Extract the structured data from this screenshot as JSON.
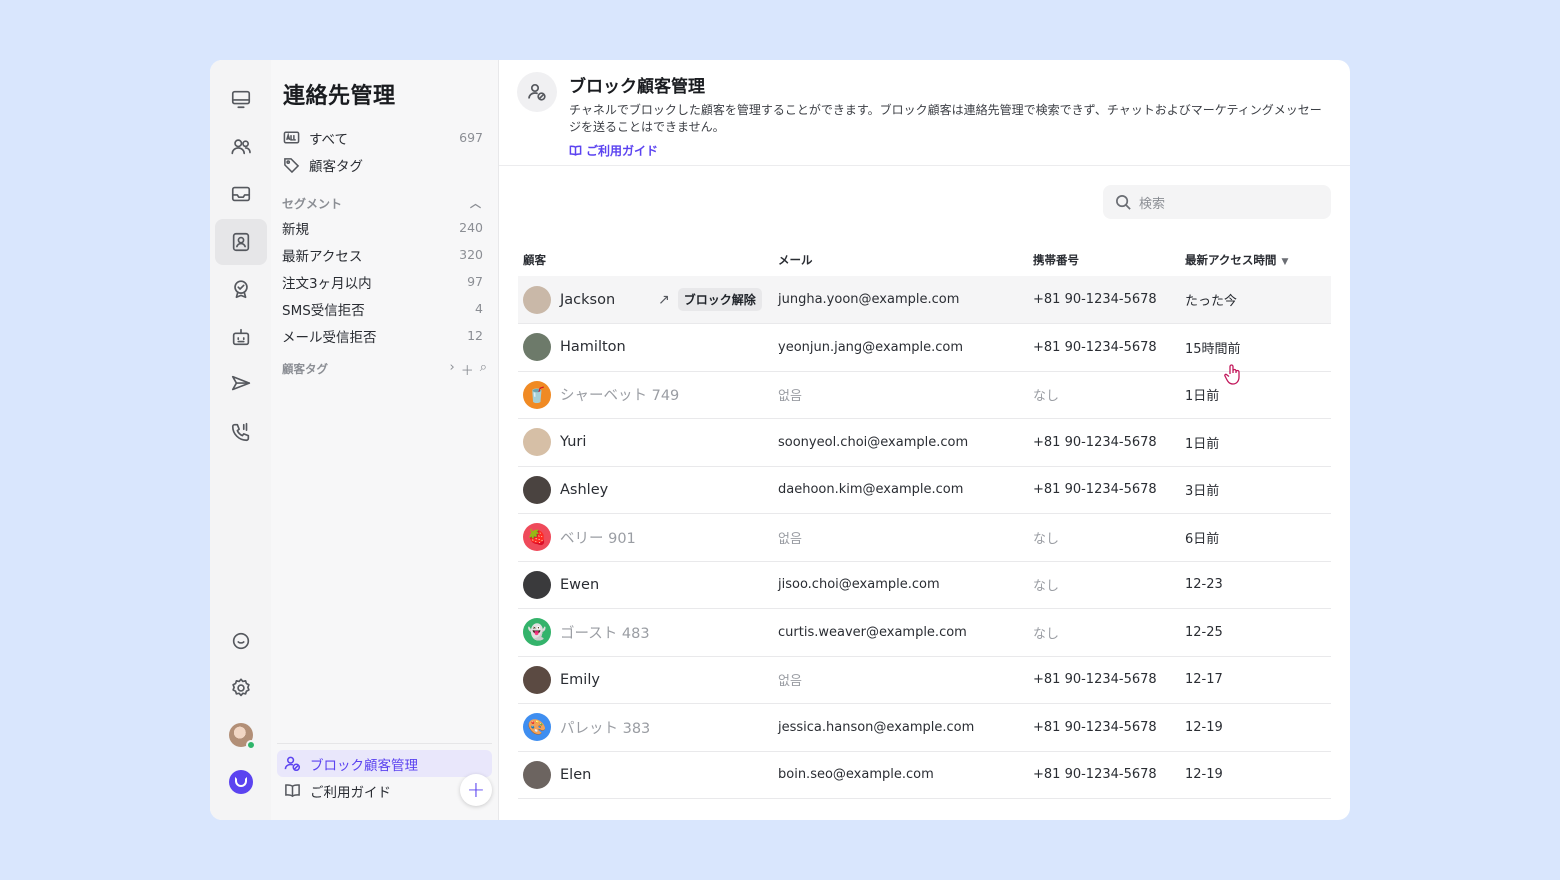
{
  "app": {
    "rail_icons": [
      "monitor-icon",
      "users-icon",
      "inbox-icon",
      "contacts-icon",
      "badge-check-icon",
      "bot-icon",
      "send-icon",
      "phone-icon"
    ],
    "rail_bottom_icons": [
      "chat-bubble-icon",
      "settings-icon",
      "user-avatar",
      "brand-logo"
    ]
  },
  "sidebar": {
    "title": "連絡先管理",
    "top_items": [
      {
        "icon": "all-icon",
        "label": "すべて",
        "count": "697"
      },
      {
        "icon": "tag-icon",
        "label": "顧客タグ",
        "count": ""
      }
    ],
    "segment_header": "セグメント",
    "segments": [
      {
        "label": "新規",
        "count": "240"
      },
      {
        "label": "最新アクセス",
        "count": "320"
      },
      {
        "label": "注文3ヶ月以内",
        "count": "97"
      },
      {
        "label": "SMS受信拒否",
        "count": "4"
      },
      {
        "label": "メール受信拒否",
        "count": "12"
      }
    ],
    "tag_header": "顧客タグ",
    "footer_items": [
      {
        "label": "ブロック顧客管理"
      },
      {
        "label": "ご利用ガイド"
      }
    ]
  },
  "header": {
    "title": "ブロック顧客管理",
    "description": "チャネルでブロックした顧客を管理することができます。ブロック顧客は連絡先管理で検索できず、チャットおよびマーケティングメッセージを送ることはできません。",
    "guide_link": "ご利用ガイド"
  },
  "search": {
    "placeholder": "検索"
  },
  "table": {
    "columns": [
      "顧客",
      "メール",
      "携帯番号",
      "最新アクセス時間"
    ],
    "unblock_label": "ブロック解除",
    "rows": [
      {
        "name": "Jackson",
        "guest": false,
        "email": "jungha.yoon@example.com",
        "phone": "+81 90-1234-5678",
        "last": "たった今",
        "avatar": "#c9b8a8",
        "glyph": ""
      },
      {
        "name": "Hamilton",
        "guest": false,
        "email": "yeonjun.jang@example.com",
        "phone": "+81 90-1234-5678",
        "last": "15時間前",
        "avatar": "#6d7a6a",
        "glyph": ""
      },
      {
        "name": "シャーベット 749",
        "guest": true,
        "email": "없음",
        "phone": "なし",
        "last": "1日前",
        "avatar": "#f08a24",
        "glyph": "🥤"
      },
      {
        "name": "Yuri",
        "guest": false,
        "email": "soonyeol.choi@example.com",
        "phone": "+81 90-1234-5678",
        "last": "1日前",
        "avatar": "#d6bfa6",
        "glyph": ""
      },
      {
        "name": "Ashley",
        "guest": false,
        "email": "daehoon.kim@example.com",
        "phone": "+81 90-1234-5678",
        "last": "3日前",
        "avatar": "#4a4340",
        "glyph": ""
      },
      {
        "name": "ベリー 901",
        "guest": true,
        "email": "없음",
        "phone": "なし",
        "last": "6日前",
        "avatar": "#ef4a5a",
        "glyph": "🍓"
      },
      {
        "name": "Ewen",
        "guest": false,
        "email": "jisoo.choi@example.com",
        "phone": "なし",
        "last": "12-23",
        "avatar": "#3a3a3c",
        "glyph": ""
      },
      {
        "name": "ゴースト 483",
        "guest": true,
        "email": "curtis.weaver@example.com",
        "phone": "なし",
        "last": "12-25",
        "avatar": "#34b36b",
        "glyph": "👻"
      },
      {
        "name": "Emily",
        "guest": false,
        "email": "없음",
        "phone": "+81 90-1234-5678",
        "last": "12-17",
        "avatar": "#5b4a42",
        "glyph": ""
      },
      {
        "name": "パレット 383",
        "guest": true,
        "email": "jessica.hanson@example.com",
        "phone": "+81 90-1234-5678",
        "last": "12-19",
        "avatar": "#3f8ef0",
        "glyph": "🎨"
      },
      {
        "name": "Elen",
        "guest": false,
        "email": "boin.seo@example.com",
        "phone": "+81 90-1234-5678",
        "last": "12-19",
        "avatar": "#6c6460",
        "glyph": ""
      }
    ]
  },
  "colors": {
    "accent": "#5b43f0",
    "background": "#d9e6fd",
    "online": "#2fb56a"
  }
}
